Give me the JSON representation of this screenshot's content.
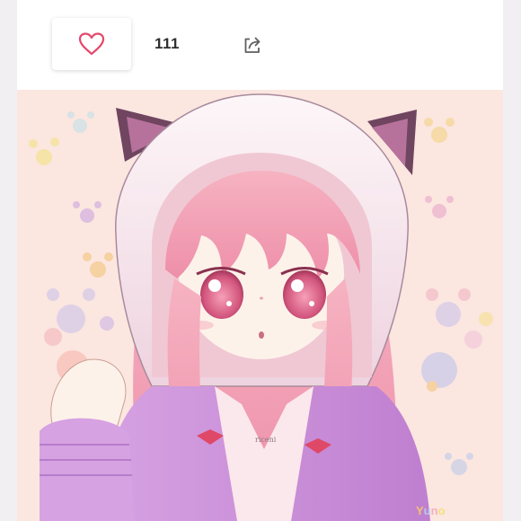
{
  "post": {
    "like_count": "111",
    "artwork_signature": "riceni",
    "artwork_caption": [
      "Y",
      "u",
      "n",
      "o"
    ]
  },
  "icons": {
    "like": "heart-outline-icon",
    "share": "share-arrow-icon"
  },
  "colors": {
    "like_accent": "#e5476b",
    "icon_gray": "#5f5f5f",
    "card_bg": "#ffffff",
    "page_bg": "#f1eff1",
    "art_bg": "#fbe6e0",
    "hair": "#f2a3b6",
    "hood": "#f7e8ee",
    "jacket": "#c78ad6"
  }
}
